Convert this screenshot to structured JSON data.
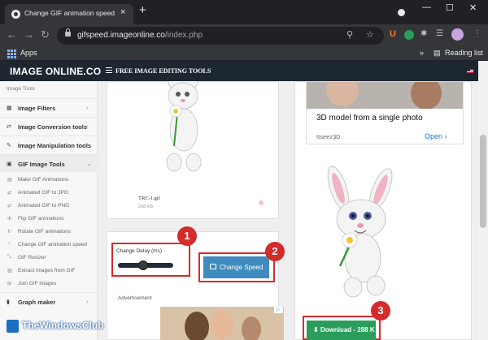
{
  "browser": {
    "tab_title": "Change GIF animation speed - Fr",
    "close_glyph": "×",
    "newtab_glyph": "+",
    "url_host": "gifspeed.imageonline.co",
    "url_path": "/index.php",
    "bookmarks": {
      "apps_label": "Apps",
      "reading_list_label": "Reading list"
    }
  },
  "site": {
    "logo": "IMAGE ONLINE.CO",
    "header_link": "FREE IMAGE EDITING TOOLS"
  },
  "sidebar": {
    "heading": "Image Tools",
    "sections": [
      {
        "label": "Image Filters"
      },
      {
        "label": "Image Conversion tools"
      },
      {
        "label": "Image Manipulation tools"
      },
      {
        "label": "GIF Image Tools"
      }
    ],
    "items": [
      "Make GIF Animations",
      "Animated GIF to JPG",
      "Animated GIF to PNG",
      "Flip GIF animations",
      "Rotate GIF animations",
      "Change GIF animation speed",
      "GIF Resizer",
      "Extract images from GIF",
      "Join GIF images"
    ],
    "bottom_section": "Graph maker"
  },
  "editor": {
    "file_name": "TRC-1.gif",
    "file_size": "268 KB",
    "delay_label": "Change Delay (ms)",
    "slider_fraction": 0.45,
    "change_button": "Change Speed",
    "advertisement_label": "Advertisement"
  },
  "right_ad": {
    "title": "3D model from a single photo",
    "source": "Itseez3D",
    "open_label": "Open"
  },
  "download_label": "Download - 288 K",
  "annotations": {
    "b1": "1",
    "b2": "2",
    "b3": "3"
  },
  "watermark": "TheWindowsClub",
  "colors": {
    "header_bg": "#1d2732",
    "change_btn": "#3f8bbf",
    "download_btn": "#2a9d5a",
    "annotation_red": "#d42b2b"
  }
}
